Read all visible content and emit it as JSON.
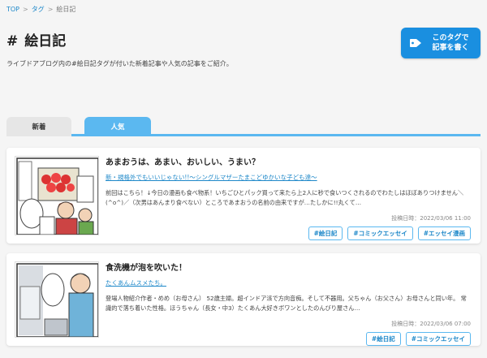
{
  "breadcrumb": {
    "top": "TOP",
    "tag": "タグ",
    "current": "絵日記",
    "sep": ">"
  },
  "title": {
    "hash": "#",
    "text": "絵日記"
  },
  "cta": {
    "line1": "このタグで",
    "line2": "記事を書く"
  },
  "description": "ライブドアブログ内の#絵日記タグが付いた新着記事や人気の記事をご紹介。",
  "tabs": [
    {
      "label": "新着"
    },
    {
      "label": "人気"
    }
  ],
  "articles": [
    {
      "title": "あまおうは、あまい、おいしい、うまい？",
      "blog": "新・規格外でもいいじゃない!!〜シングルマザーたまこどゆかいな子ども達〜",
      "excerpt": "前回はこちら！↓今日の漫画も食べ物系！いちごひとパック買って来たら上2人に秒で食いつくされるのでわたしはほぼありつけません＼(^o^)／（次男はあんまり食べない）ところであまおうの名前の由来ですが…たしかに!!丸くて…",
      "date": "投稿日時：2022/03/06 11:00",
      "tags": [
        "#絵日記",
        "#コミックエッセイ",
        "#エッセイ漫画"
      ]
    },
    {
      "title": "食洗機が泡を吹いた！",
      "blog": "たくあんムスメたち。",
      "excerpt": "登場人物紹介作者・めめ（お母さん） 52歳主婦。超インドア派で方向音痴。そして不器用。父ちゃん（お父さん）お母さんと同い年。 常識的で落ち着いた性格。ほうちゃん（長女・中3）たくあん大好きボワンとしたのんびり屋さん…",
      "date": "投稿日時：2022/03/06 07:00",
      "tags": [
        "#絵日記",
        "#コミックエッセイ"
      ]
    }
  ],
  "colors": {
    "accent": "#1a8fe0",
    "tab_active": "#5bb8f0",
    "link": "#1e88c9"
  }
}
